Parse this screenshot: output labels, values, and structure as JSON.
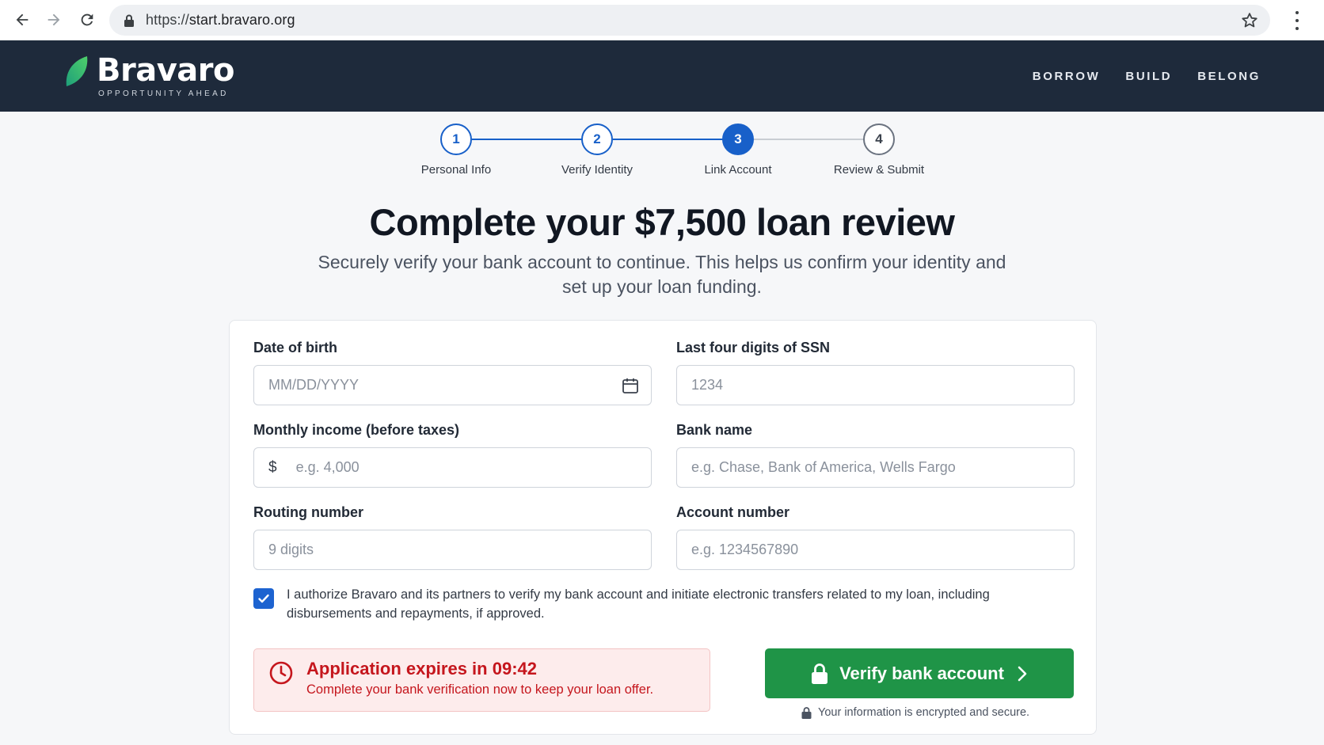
{
  "browser": {
    "url_scheme": "https://",
    "url_host": "start.bravaro.org",
    "icons": [
      "back-arrow-icon",
      "forward-arrow-icon",
      "reload-icon",
      "lock-icon",
      "star-icon",
      "kebab-menu-icon"
    ]
  },
  "brand": {
    "name": "Bravaro",
    "tagline": "OPPORTUNITY AHEAD",
    "accent": "#2bb673"
  },
  "nav": {
    "items": [
      "BORROW",
      "BUILD",
      "BELONG"
    ]
  },
  "stepper": {
    "active_index": 2,
    "steps": [
      {
        "number": "1",
        "label": "Personal Info",
        "state": "complete"
      },
      {
        "number": "2",
        "label": "Verify Identity",
        "state": "complete"
      },
      {
        "number": "3",
        "label": "Link Account",
        "state": "active"
      },
      {
        "number": "4",
        "label": "Review & Submit",
        "state": "pending"
      }
    ],
    "colors": {
      "active": "#1860c9",
      "complete_line": "#1860c9",
      "pending_line": "#c9cdd3",
      "pending_border": "#6b7380"
    }
  },
  "hero": {
    "title": "Complete your $7,500 loan review",
    "subtitle": "Securely verify your bank account to continue. This helps us confirm your identity and set up your loan funding."
  },
  "form": {
    "dob": {
      "label": "Date of birth",
      "value": "",
      "placeholder": "MM/DD/YYYY"
    },
    "ssn": {
      "label": "Last four digits of SSN",
      "value": "",
      "placeholder": "1234"
    },
    "income": {
      "label": "Monthly income (before taxes)",
      "prefix": "$",
      "value": "",
      "placeholder": "e.g. 4,000"
    },
    "bank": {
      "label": "Bank name",
      "value": "",
      "placeholder": "e.g. Chase, Bank of America, Wells Fargo"
    },
    "routing": {
      "label": "Routing number",
      "value": "",
      "placeholder": "9 digits"
    },
    "account": {
      "label": "Account number",
      "value": "",
      "placeholder": "e.g. 1234567890"
    },
    "consent": {
      "checked": true,
      "text": "I authorize Bravaro and its partners to verify my bank account and initiate electronic transfers related to my loan, including disbursements and repayments, if approved."
    }
  },
  "alert": {
    "title": "Application expires in 09:42",
    "body": "Complete your bank verification now to keep your loan offer.",
    "color": "#c5161d"
  },
  "cta": {
    "label": "Verify bank account",
    "color": "#1f9447",
    "secure_note": "Your information is encrypted and secure."
  }
}
